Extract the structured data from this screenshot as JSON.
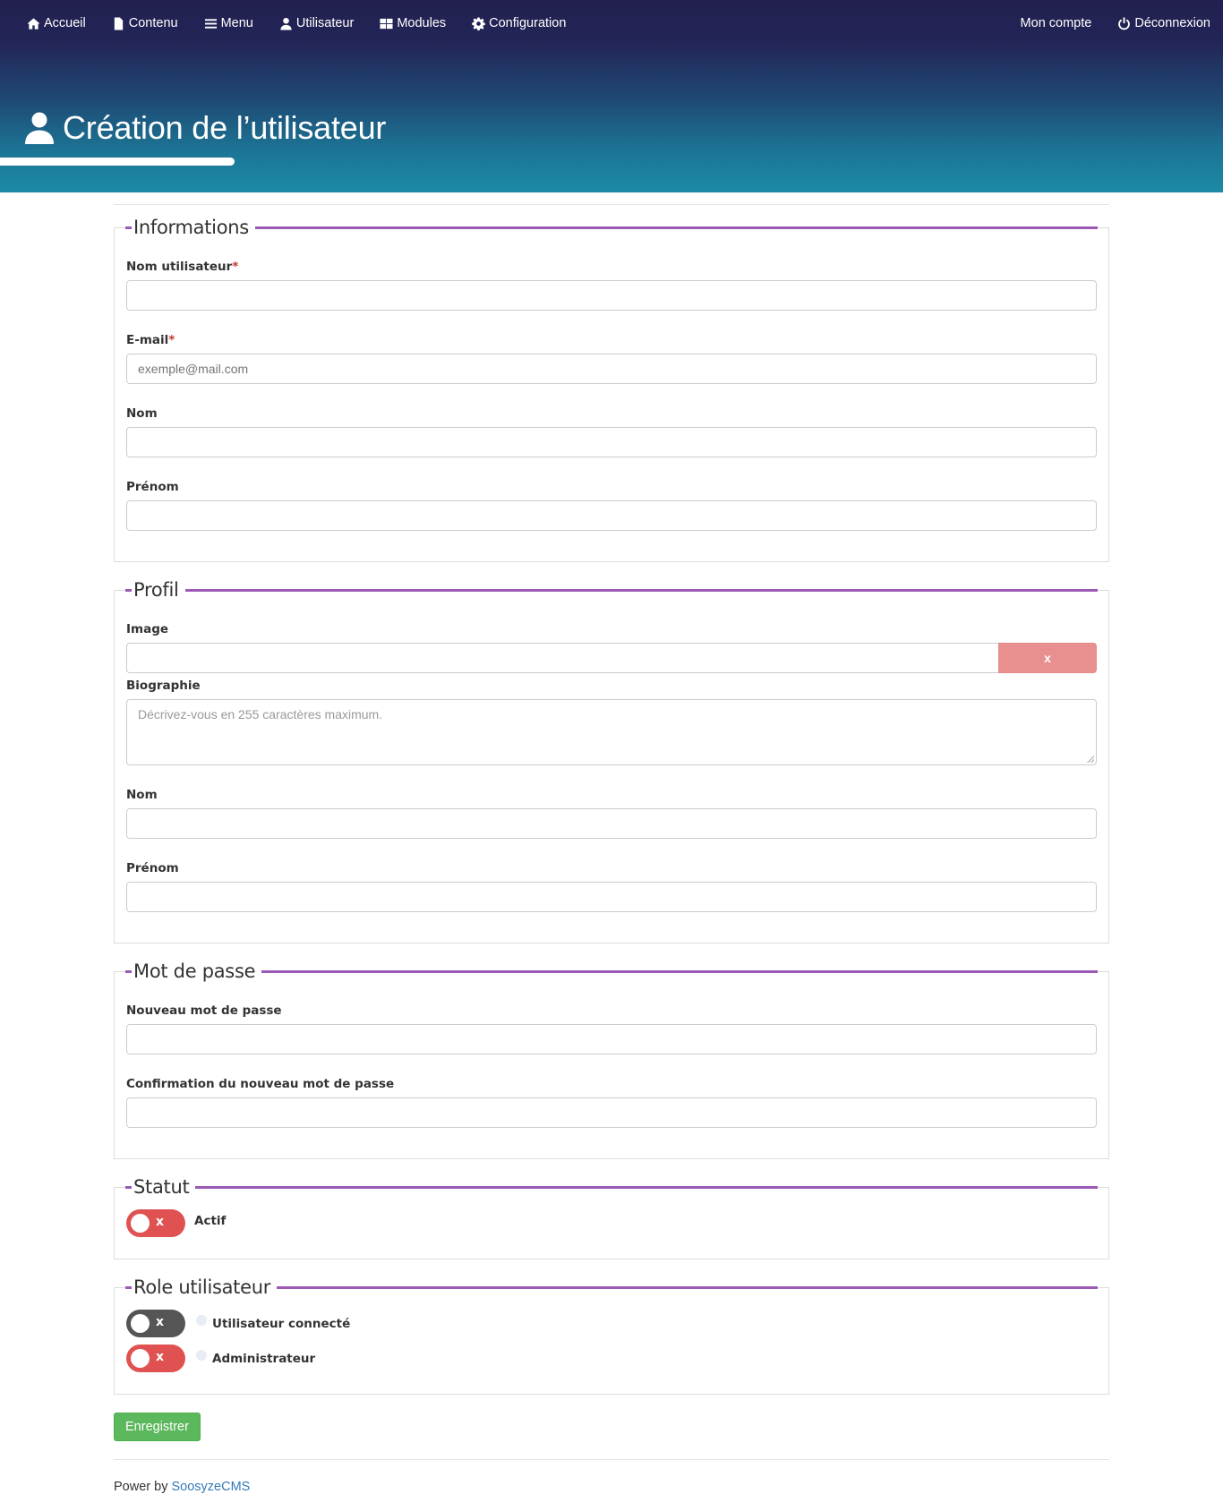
{
  "nav": {
    "left": [
      {
        "label": "Accueil",
        "icon": "home-icon"
      },
      {
        "label": "Contenu",
        "icon": "file-icon"
      },
      {
        "label": "Menu",
        "icon": "bars-icon"
      },
      {
        "label": "Utilisateur",
        "icon": "user-icon"
      },
      {
        "label": "Modules",
        "icon": "grid-icon"
      },
      {
        "label": "Configuration",
        "icon": "gear-icon"
      }
    ],
    "account": "Mon compte",
    "logout": "Déconnexion"
  },
  "page_title": "Création de l’utilisateur",
  "colors": {
    "accent": "#9b59b6",
    "toggle_red": "#e05252",
    "toggle_gray": "#555555",
    "save_green": "#5cb85c",
    "clear_button": "#e8908f",
    "link": "#337ab7"
  },
  "sections": {
    "informations": {
      "legend": "Informations",
      "username_label": "Nom utilisateur",
      "username_value": "",
      "email_label": "E-mail",
      "email_placeholder": "exemple@mail.com",
      "lastname_label": "Nom",
      "firstname_label": "Prénom",
      "required_mark": "*"
    },
    "profil": {
      "legend": "Profil",
      "image_label": "Image",
      "clear_label": "x",
      "bio_label": "Biographie",
      "bio_placeholder": "Décrivez-vous en 255 caractères maximum.",
      "lastname_label": "Nom",
      "firstname_label": "Prénom"
    },
    "password": {
      "legend": "Mot de passe",
      "new_label": "Nouveau mot de passe",
      "confirm_label": "Confirmation du nouveau mot de passe"
    },
    "statut": {
      "legend": "Statut",
      "active_label": "Actif",
      "active_mark": "x"
    },
    "roles": {
      "legend": "Role utilisateur",
      "items": [
        {
          "label": "Utilisateur connecté",
          "mark": "x"
        },
        {
          "label": "Administrateur",
          "mark": "x"
        }
      ]
    }
  },
  "save_label": "Enregistrer",
  "footer": {
    "prefix": "Power by",
    "link": "SoosyzeCMS"
  }
}
